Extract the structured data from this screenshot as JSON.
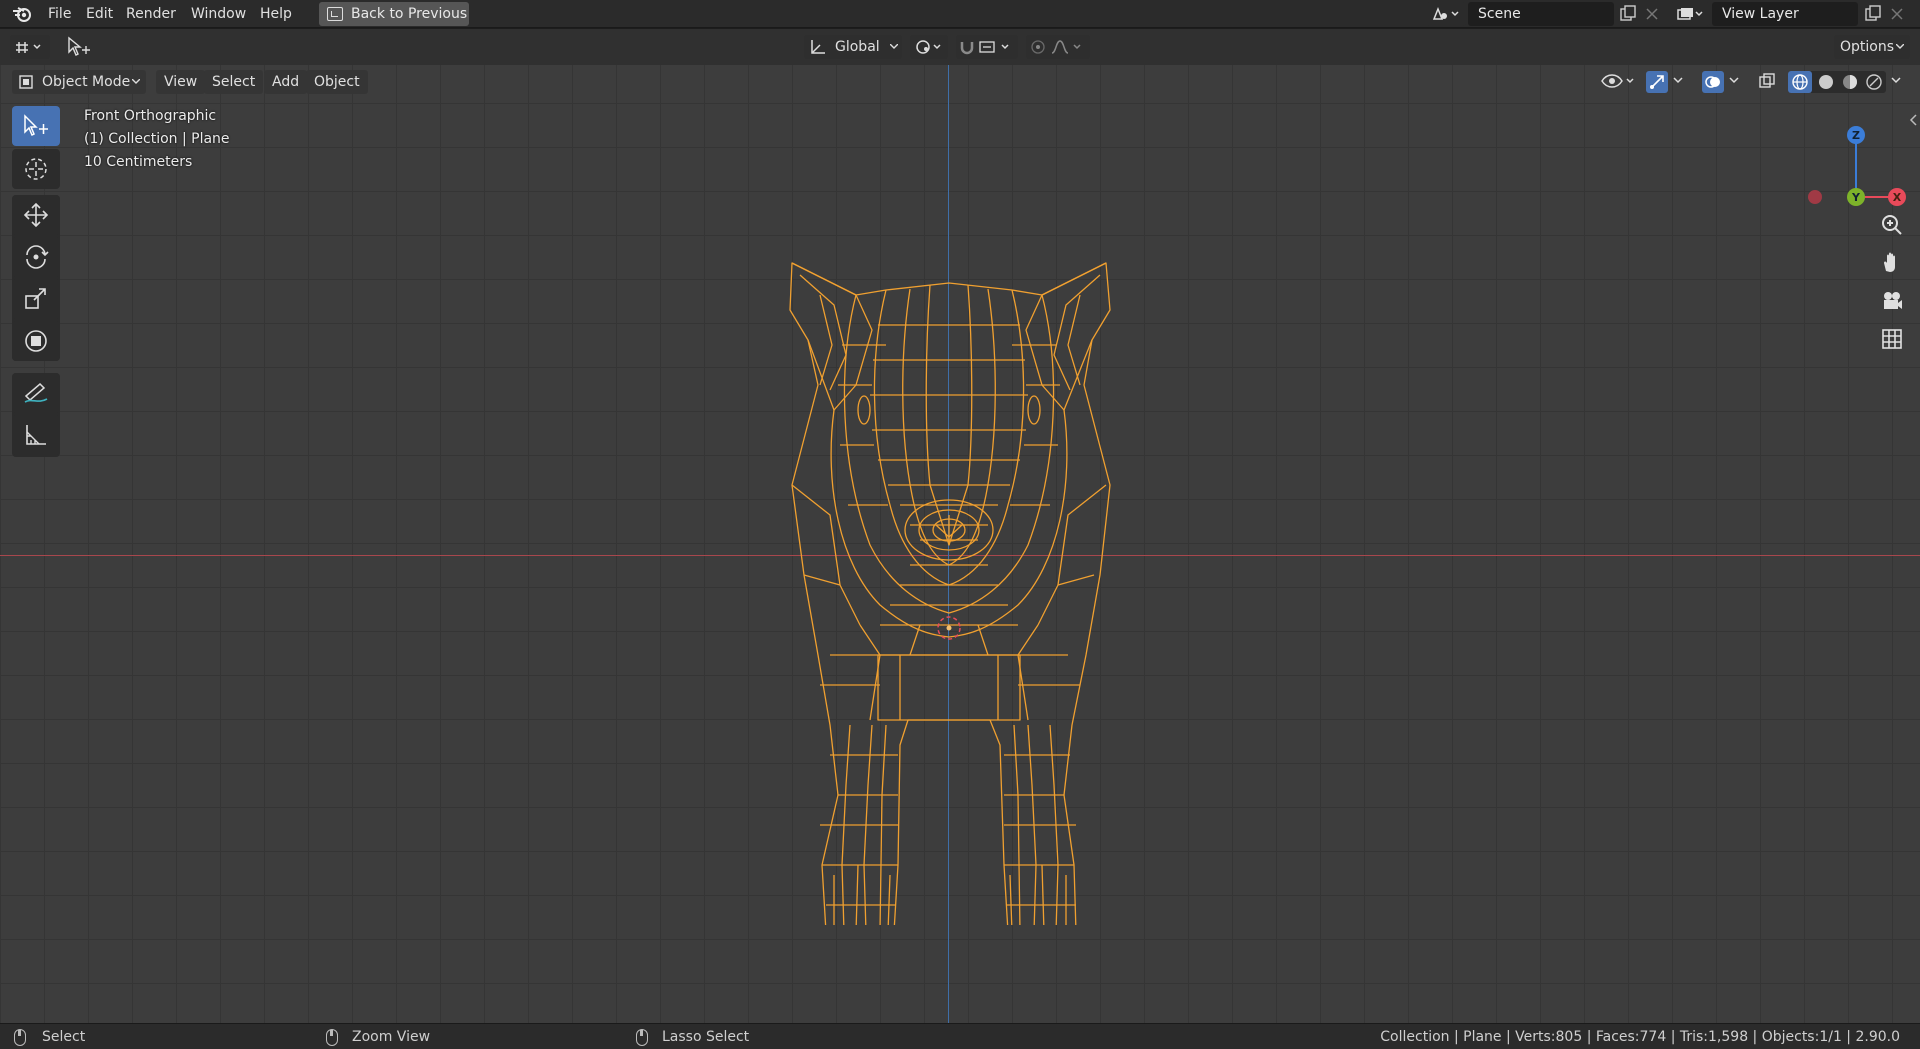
{
  "menubar": {
    "items": [
      "File",
      "Edit",
      "Render",
      "Window",
      "Help"
    ],
    "back_button": "Back to Previous",
    "scene": "Scene",
    "view_layer": "View Layer"
  },
  "header": {
    "orientation": "Global",
    "options": "Options"
  },
  "viewport": {
    "mode": "Object Mode",
    "menu": [
      "View",
      "Select",
      "Add",
      "Object"
    ],
    "info": {
      "view": "Front Orthographic",
      "collection": "(1) Collection | Plane",
      "scale": "10 Centimeters"
    },
    "gizmo": {
      "z": "Z",
      "y": "Y",
      "x": "X"
    },
    "colors": {
      "wire": "#f0a030",
      "accent": "#4772b3",
      "x_axis": "#a8474d",
      "z_axis": "#3f6fa9"
    }
  },
  "toolbar": {
    "tools": [
      "select-box",
      "cursor",
      "move",
      "rotate",
      "scale",
      "transform",
      "annotate",
      "measure"
    ]
  },
  "statusbar": {
    "left": "Select",
    "middle": "Zoom View",
    "right_action": "Lasso Select",
    "stats": "Collection | Plane | Verts:805 | Faces:774 | Tris:1,598 | Objects:1/1 | 2.90.0"
  }
}
